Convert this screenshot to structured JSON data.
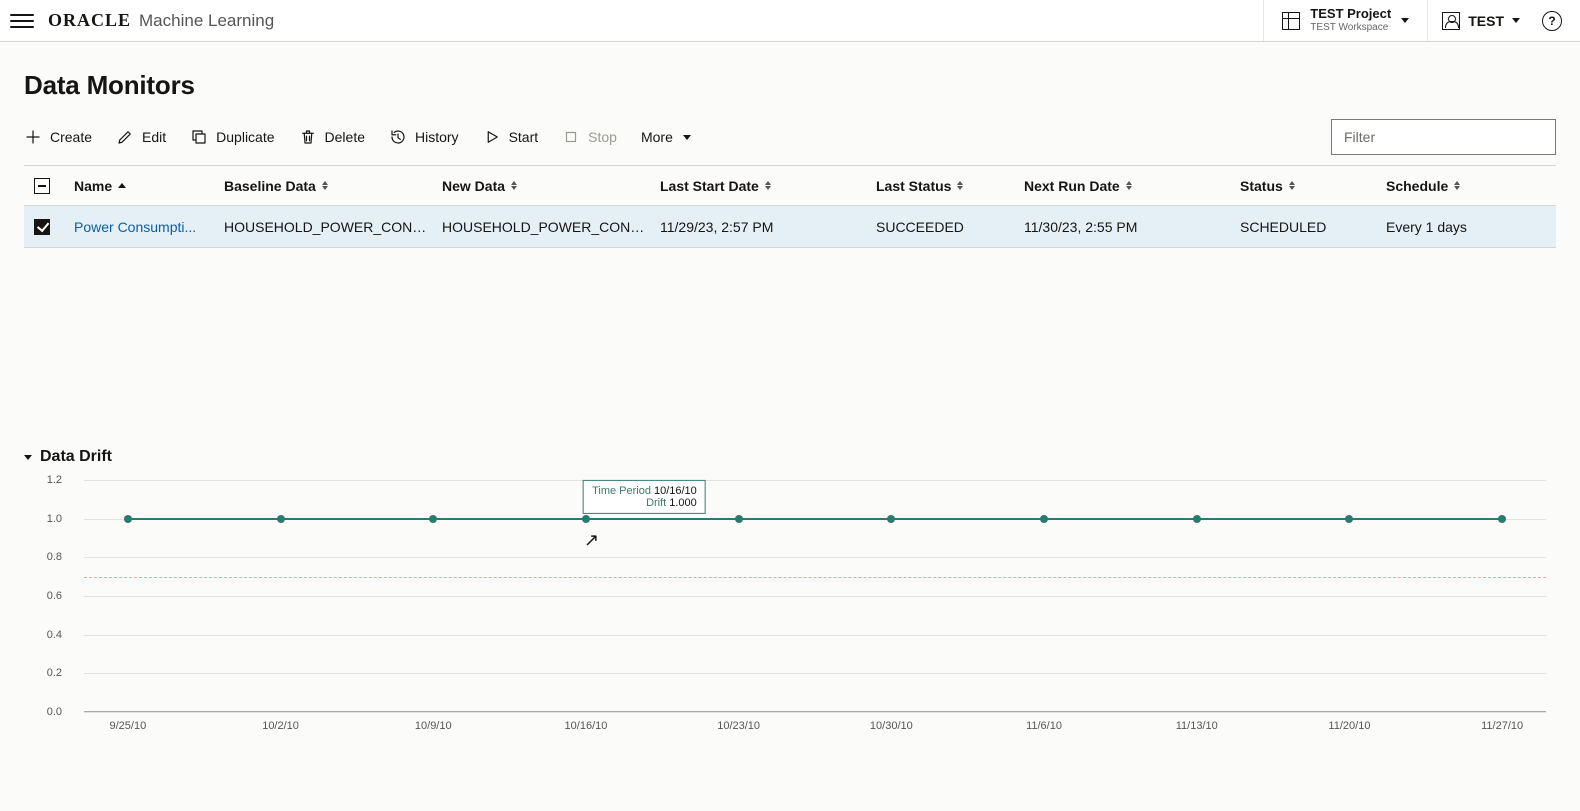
{
  "header": {
    "logo": "ORACLE",
    "product": "Machine Learning",
    "project_name": "TEST Project",
    "workspace": "TEST Workspace",
    "user": "TEST"
  },
  "page": {
    "title": "Data Monitors"
  },
  "toolbar": {
    "create": "Create",
    "edit": "Edit",
    "duplicate": "Duplicate",
    "delete": "Delete",
    "history": "History",
    "start": "Start",
    "stop": "Stop",
    "more": "More",
    "filter_placeholder": "Filter"
  },
  "table": {
    "headers": {
      "name": "Name",
      "baseline": "Baseline Data",
      "newdata": "New Data",
      "laststart": "Last Start Date",
      "laststatus": "Last Status",
      "nextrun": "Next Run Date",
      "status": "Status",
      "schedule": "Schedule"
    },
    "row": {
      "name": "Power Consumpti...",
      "baseline": "HOUSEHOLD_POWER_CONS...",
      "newdata": "HOUSEHOLD_POWER_CONS...",
      "laststart": "11/29/23, 2:57 PM",
      "laststatus": "SUCCEEDED",
      "nextrun": "11/30/23, 2:55 PM",
      "status": "SCHEDULED",
      "schedule": "Every 1 days"
    }
  },
  "section": {
    "title": "Data Drift"
  },
  "tooltip": {
    "k1": "Time Period",
    "v1": "10/16/10",
    "k2": "Drift",
    "v2": "1.000"
  },
  "chart_data": {
    "type": "line",
    "xlabel": "",
    "ylabel": "",
    "ylim": [
      0.0,
      1.2
    ],
    "y_ticks": [
      0.0,
      0.2,
      0.4,
      0.6,
      0.8,
      1.0,
      1.2
    ],
    "threshold": 0.7,
    "x_tick_labels": [
      "9/25/10",
      "10/2/10",
      "10/9/10",
      "10/16/10",
      "10/23/10",
      "10/30/10",
      "11/6/10",
      "11/13/10",
      "11/20/10",
      "11/27/10"
    ],
    "categories": [
      "9/25/10",
      "10/2/10",
      "10/9/10",
      "10/16/10",
      "10/23/10",
      "10/30/10",
      "11/6/10",
      "11/13/10",
      "11/20/10",
      "11/27/10"
    ],
    "values": [
      1.0,
      1.0,
      1.0,
      1.0,
      1.0,
      1.0,
      1.0,
      1.0,
      1.0,
      1.0
    ],
    "hover_index": 3
  }
}
